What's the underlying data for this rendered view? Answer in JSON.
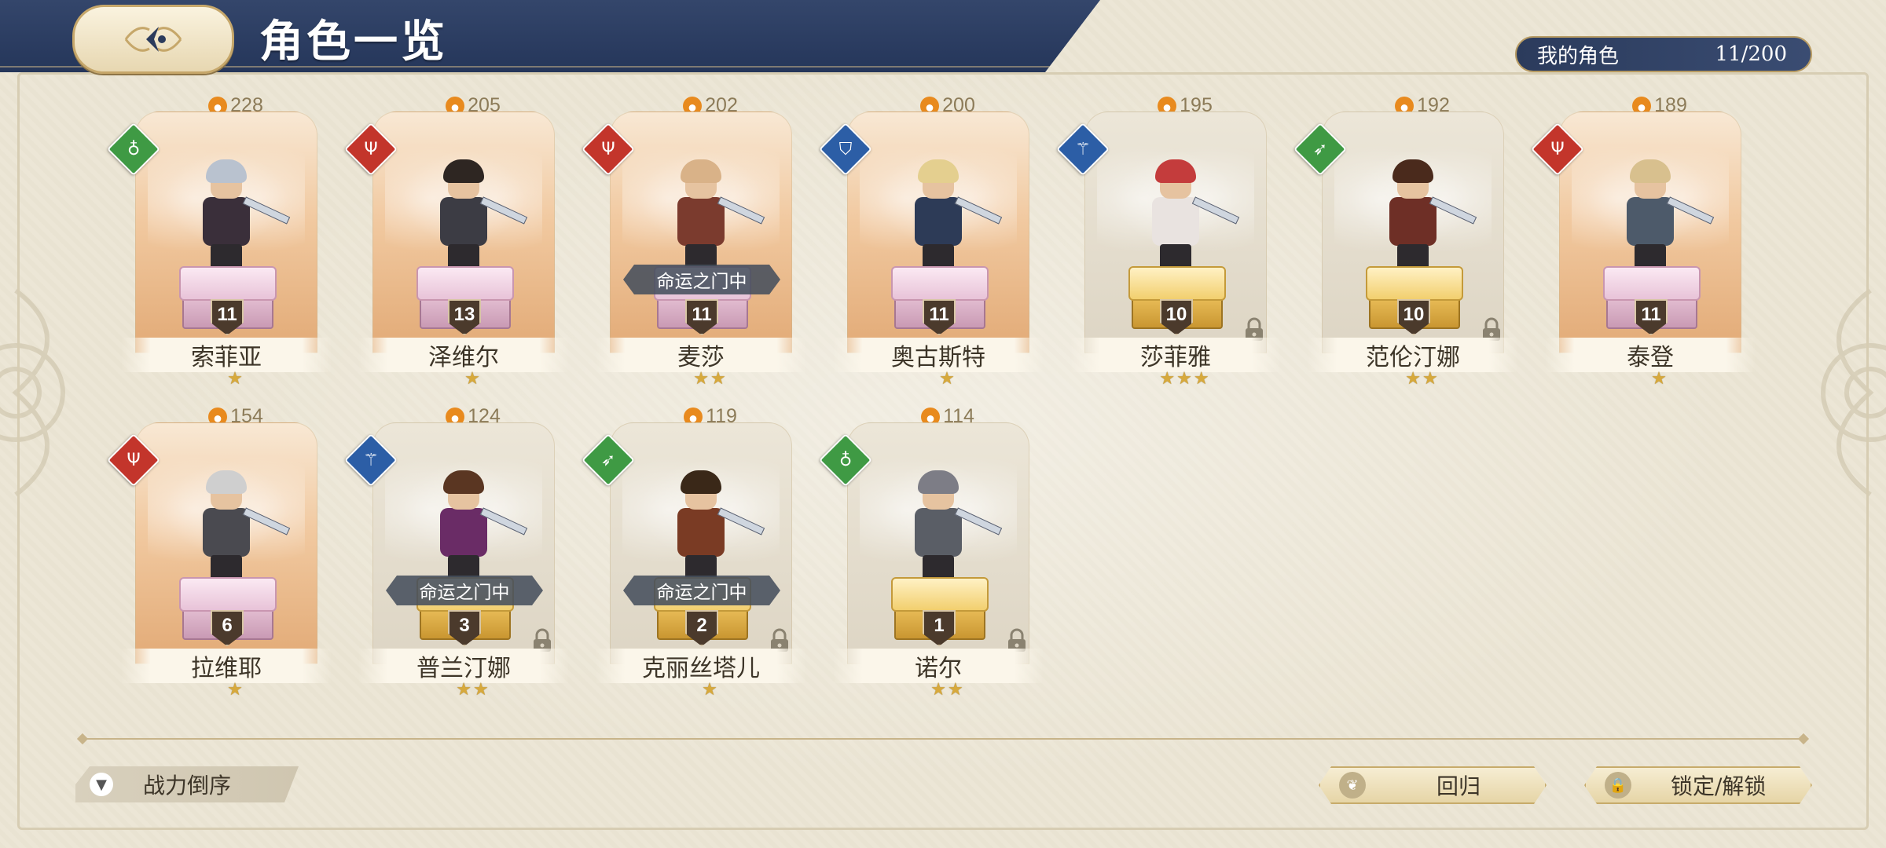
{
  "header": {
    "title": "角色一览",
    "owned_label": "我的角色",
    "owned_count": "11/200"
  },
  "characters": [
    {
      "name": "索菲亚",
      "power": "228",
      "level": "11",
      "stars": "★",
      "pedestal": "pink",
      "bg": "gold",
      "class": "green",
      "class_icon": "sword-icon",
      "fate": "",
      "locked": false
    },
    {
      "name": "泽维尔",
      "power": "205",
      "level": "13",
      "stars": "★",
      "pedestal": "pink",
      "bg": "gold",
      "class": "red",
      "class_icon": "trident-icon",
      "fate": "",
      "locked": false
    },
    {
      "name": "麦莎",
      "power": "202",
      "level": "11",
      "stars": "★★",
      "pedestal": "pink",
      "bg": "gold",
      "class": "red",
      "class_icon": "trident-icon",
      "fate": "命运之门中",
      "locked": false
    },
    {
      "name": "奥古斯特",
      "power": "200",
      "level": "11",
      "stars": "★",
      "pedestal": "pink",
      "bg": "gold",
      "class": "blue",
      "class_icon": "shield-icon",
      "fate": "",
      "locked": false
    },
    {
      "name": "莎菲雅",
      "power": "195",
      "level": "10",
      "stars": "★★★",
      "pedestal": "gold",
      "bg": "gray",
      "class": "blue",
      "class_icon": "staff-icon",
      "fate": "",
      "locked": true
    },
    {
      "name": "范伦汀娜",
      "power": "192",
      "level": "10",
      "stars": "★★",
      "pedestal": "gold",
      "bg": "gray",
      "class": "green",
      "class_icon": "bow-icon",
      "fate": "",
      "locked": true
    },
    {
      "name": "泰登",
      "power": "189",
      "level": "11",
      "stars": "★",
      "pedestal": "pink",
      "bg": "gold",
      "class": "red",
      "class_icon": "trident-icon",
      "fate": "",
      "locked": false
    },
    {
      "name": "拉维耶",
      "power": "154",
      "level": "6",
      "stars": "★",
      "pedestal": "pink",
      "bg": "gold",
      "class": "red",
      "class_icon": "trident-icon",
      "fate": "",
      "locked": false
    },
    {
      "name": "普兰汀娜",
      "power": "124",
      "level": "3",
      "stars": "★★",
      "pedestal": "gold",
      "bg": "gray",
      "class": "blue",
      "class_icon": "staff-icon",
      "fate": "命运之门中",
      "locked": true
    },
    {
      "name": "克丽丝塔儿",
      "power": "119",
      "level": "2",
      "stars": "★",
      "pedestal": "gold",
      "bg": "gray",
      "class": "green",
      "class_icon": "bow-icon",
      "fate": "命运之门中",
      "locked": true
    },
    {
      "name": "诺尔",
      "power": "114",
      "level": "1",
      "stars": "★★",
      "pedestal": "gold",
      "bg": "gray",
      "class": "green",
      "class_icon": "sword-icon",
      "fate": "",
      "locked": true
    }
  ],
  "footer": {
    "sort_label": "战力倒序",
    "return_label": "回归",
    "lock_label": "锁定/解锁"
  },
  "colors": {
    "class_red": "#c3352b",
    "class_green": "#3f9a44",
    "class_blue": "#2c5ea6",
    "header_navy": "#2b3b5c",
    "star_gold": "#d7a93c"
  }
}
